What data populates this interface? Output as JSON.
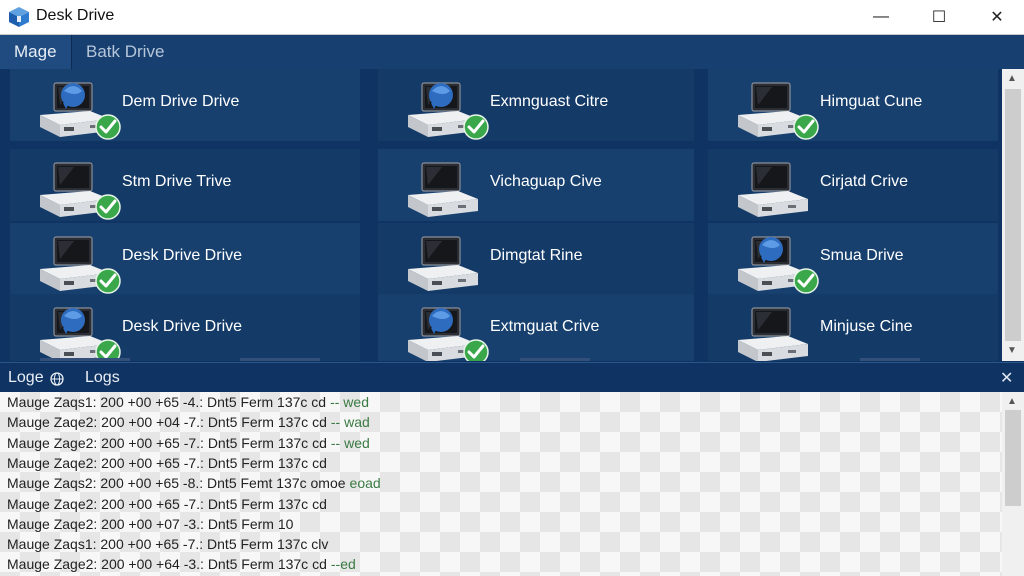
{
  "window": {
    "title": "Desk Drive",
    "minimize_glyph": "—",
    "maximize_glyph": "☐",
    "close_glyph": "✕"
  },
  "tabs": [
    {
      "label": "Mage",
      "active": true
    },
    {
      "label": "Batk Drive",
      "active": false
    }
  ],
  "drives": [
    {
      "label": "Dem Drive Drive",
      "icon": "network-drive-icon",
      "status": "ok"
    },
    {
      "label": "Exmnguast Citre",
      "icon": "network-drive-icon",
      "status": "ok"
    },
    {
      "label": "Himguat Cune",
      "icon": "computer-drive-icon",
      "status": "ok"
    },
    {
      "label": "Stm Drive Trive",
      "icon": "computer-drive-icon",
      "status": "ok"
    },
    {
      "label": "Vichaguap Cive",
      "icon": "computer-drive-icon",
      "status": "none"
    },
    {
      "label": "Cirjatd Crive",
      "icon": "computer-drive-icon",
      "status": "none"
    },
    {
      "label": "Desk Drive Drive",
      "icon": "computer-drive-icon",
      "status": "ok"
    },
    {
      "label": "Dimgtat Rine",
      "icon": "computer-drive-icon",
      "status": "none"
    },
    {
      "label": "Smua Drive",
      "icon": "network-drive-icon",
      "status": "ok"
    },
    {
      "label": "Desk Drive Drive",
      "icon": "network-drive-icon",
      "status": "ok"
    },
    {
      "label": "Extmguat Crive",
      "icon": "network-drive-icon",
      "status": "ok"
    },
    {
      "label": "Minjuse Cine",
      "icon": "computer-drive-icon",
      "status": "none"
    }
  ],
  "logs": {
    "tab1_label": "Loge",
    "tab2_label": "Logs",
    "close_glyph": "✕",
    "lines": [
      {
        "text": "Mauge Zaqs1:  200 +00 +65 -4.: Dnt5 Ferm 137c cd",
        "tail": "-- wed"
      },
      {
        "text": "Mauge Zaqe2:  200 +00 +04 -7.: Dnt5 Ferm 137c cd",
        "tail": "-- wad"
      },
      {
        "text": "Mauge Zage2:  200 +00 +65 -7.: Dnt5 Ferm 137c cd",
        "tail": "-- wed"
      },
      {
        "text": "Mauge Zaqe2:  200 +00 +65 -7.: Dnt5 Ferm 137c cd",
        "tail": ""
      },
      {
        "text": "Mauge Zaqs2:  200 +00 +65 -8.: Dnt5 Femt 137c omoe",
        "tail": "eoad"
      },
      {
        "text": "Mauge Zaqe2:  200 +00 +65 -7.: Dnt5 Ferm 137c cd",
        "tail": ""
      },
      {
        "text": "Mauge Zaqe2:  200 +00 +07 -3.: Dnt5 Ferm 10",
        "tail": ""
      },
      {
        "text": "Mauge Zaqs1:  200 +00 +65 -7.: Dnt5 Ferm 137c clv",
        "tail": ""
      },
      {
        "text": "Mauge Zage2:  200 +00 +64 -3.: Dnt5 Ferm 137c cd",
        "tail": "--ed"
      }
    ]
  },
  "colors": {
    "ok_badge": "#3aa84a",
    "accent": "#173f70"
  }
}
